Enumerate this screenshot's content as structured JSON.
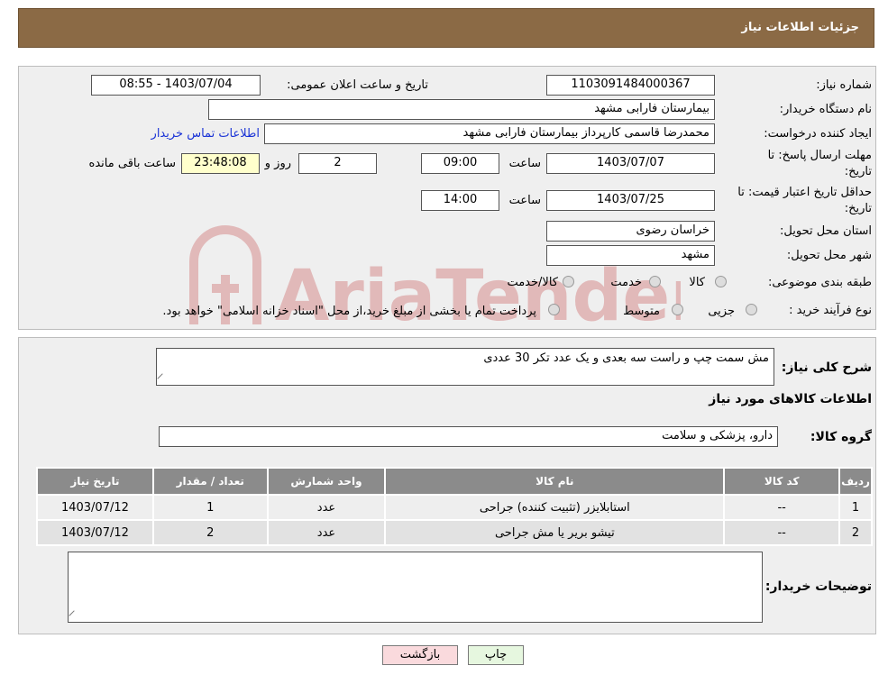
{
  "header": {
    "title": "جزئیات اطلاعات نیاز"
  },
  "form": {
    "need_number_label": "شماره نیاز:",
    "need_number": "1103091484000367",
    "announce_label": "تاریخ و ساعت اعلان عمومی:",
    "announce_value": "1403/07/04 - 08:55",
    "buyer_org_label": "نام دستگاه خریدار:",
    "buyer_org": "بیمارستان فارابی مشهد",
    "creator_label": "ایجاد کننده درخواست:",
    "creator": "محمدرضا قاسمی کارپرداز بیمارستان فارابی مشهد",
    "contact_link": "اطلاعات تماس خریدار",
    "deadline_label_1": "مهلت ارسال پاسخ: تا",
    "deadline_label_2": "تاریخ:",
    "deadline_date": "1403/07/07",
    "time_label": "ساعت",
    "deadline_time": "09:00",
    "days_value": "2",
    "days_label": "روز و",
    "remaining_time": "23:48:08",
    "remaining_label": "ساعت باقی مانده",
    "validity_label_1": "حداقل تاریخ اعتبار قیمت: تا",
    "validity_label_2": "تاریخ:",
    "validity_date": "1403/07/25",
    "validity_time": "14:00",
    "province_label": "استان محل تحویل:",
    "province": "خراسان رضوی",
    "city_label": "شهر محل تحویل:",
    "city": "مشهد",
    "category_label": "طبقه بندی موضوعی:",
    "category_options": [
      "کالا",
      "خدمت",
      "کالا/خدمت"
    ],
    "process_label": "نوع فرآیند خرید :",
    "process_options": [
      "جزیی",
      "متوسط"
    ],
    "process_note": "پرداخت تمام یا بخشی از مبلغ خرید،از محل \"اسناد خزانه اسلامی\" خواهد بود."
  },
  "details": {
    "summary_label": "شرح کلی نیاز:",
    "summary": "مش سمت چپ و راست سه بعدی  و یک عدد تکر 30 عددی",
    "goods_info_title": "اطلاعات کالاهای مورد نیاز",
    "goods_group_label": "گروه کالا:",
    "goods_group": "دارو، پزشکی و سلامت",
    "table": {
      "headers": [
        "ردیف",
        "کد کالا",
        "نام کالا",
        "واحد شمارش",
        "تعداد / مقدار",
        "تاریخ نیاز"
      ],
      "rows": [
        [
          "1",
          "--",
          "استابلایزر (تثبیت کننده) جراحی",
          "عدد",
          "1",
          "1403/07/12"
        ],
        [
          "2",
          "--",
          "تیشو بریر یا مش جراحی",
          "عدد",
          "2",
          "1403/07/12"
        ]
      ]
    },
    "buyer_notes_label": "توضیحات خریدار:",
    "buyer_notes": ""
  },
  "buttons": {
    "print": "چاپ",
    "back": "بازگشت"
  },
  "colors": {
    "header": "#8b6a45",
    "table_header": "#8b8b8b",
    "back_button": "#fadadd",
    "print_button": "#e6f7df",
    "link": "#1a33d6"
  }
}
